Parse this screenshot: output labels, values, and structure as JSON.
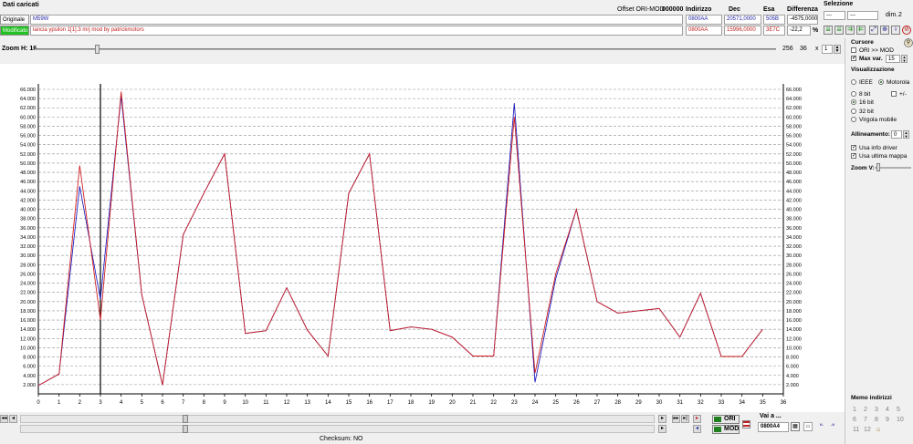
{
  "header": {
    "title": "Dati caricati",
    "offset_label": "Offset ORI-MOD",
    "offset_value": "000000",
    "col_address": "Indirizzo",
    "col_dec": "Dec",
    "col_hex": "Esa",
    "col_diff": "Differenza",
    "original_tag": "Originale",
    "original_name": "M59W",
    "original_address": "0800AA",
    "original_dec": "20571,0000",
    "original_hex": "505B",
    "original_diff": "-4575,0000",
    "modified_tag": "Modificato",
    "modified_name": "lancia ypsilon 1[1].3 mrj mod by patrickmotors",
    "modified_address": "0800AA",
    "modified_dec": "15996,0000",
    "modified_hex": "3E7C",
    "modified_diff": "-22,2",
    "percent": "%"
  },
  "selection": {
    "title": "Selezione",
    "field1": "---",
    "field2": "---",
    "dim_label": "dim.",
    "dim_value": "2"
  },
  "zoom": {
    "label": "Zoom H: 16",
    "value1": "256",
    "value2": "36",
    "x_label": "x",
    "value3": "1"
  },
  "panel": {
    "cursor_title": "Cursore",
    "ori_mod": "ORI >> MOD",
    "max_var_label": "Max var.",
    "max_var_value": "15",
    "view_title": "Visualizzazione",
    "ieee": "IEEE",
    "motorola": "Motorola",
    "bit8": "8 bit",
    "plusminus": "+/-",
    "bit16": "16 bit",
    "bit32": "32 bit",
    "float": "Virgola mobile",
    "align_label": "Allineamento:",
    "align_value": "0",
    "use_driver": "Usa info driver",
    "use_last_map": "Usa ultima mappa",
    "zoom_v": "Zoom V:",
    "memo_title": "Memo indirizzi",
    "memo_items": [
      "1",
      "2",
      "3",
      "4",
      "5",
      "6",
      "7",
      "8",
      "9",
      "10",
      "11",
      "12"
    ]
  },
  "bottom": {
    "ori": "ORI",
    "mod": "MOD",
    "goto_label": "Vai a ...",
    "goto_value": "0800A4",
    "checksum": "Checksum: NO"
  },
  "colors": {
    "original": "#2020c0",
    "modified": "#d02020",
    "grid": "#909090"
  },
  "chart_data": {
    "type": "line",
    "x": [
      0,
      1,
      2,
      3,
      4,
      5,
      6,
      7,
      8,
      9,
      10,
      11,
      12,
      13,
      14,
      15,
      16,
      17,
      18,
      19,
      20,
      21,
      22,
      23,
      24,
      25,
      26,
      27,
      28,
      29,
      30,
      31,
      32,
      33,
      34,
      35
    ],
    "xlim": [
      0,
      36
    ],
    "ylim": [
      0,
      66000
    ],
    "yticks": [
      "2.000",
      "4.000",
      "6.000",
      "8.000",
      "10.000",
      "12.000",
      "14.000",
      "16.000",
      "18.000",
      "20.000",
      "22.000",
      "24.000",
      "26.000",
      "28.000",
      "30.000",
      "32.000",
      "34.000",
      "36.000",
      "38.000",
      "40.000",
      "42.000",
      "44.000",
      "46.000",
      "48.000",
      "50.000",
      "52.000",
      "54.000",
      "56.000",
      "58.000",
      "60.000",
      "62.000",
      "64.000",
      "66.000"
    ],
    "xticks": [
      "0",
      "1",
      "2",
      "3",
      "4",
      "5",
      "6",
      "7",
      "8",
      "9",
      "10",
      "11",
      "12",
      "13",
      "14",
      "15",
      "16",
      "17",
      "18",
      "19",
      "20",
      "21",
      "22",
      "23",
      "24",
      "25",
      "26",
      "27",
      "28",
      "29",
      "30",
      "31",
      "32",
      "33",
      "34",
      "35",
      "36"
    ],
    "cursor_x": 3,
    "series": [
      {
        "values": [
          1800,
          4300,
          45000,
          20500,
          64500,
          21500,
          1900,
          34500,
          43500,
          52000,
          13100,
          13700,
          23000,
          13800,
          8200,
          43500,
          52000,
          13700,
          14500,
          14000,
          12300,
          8200,
          8200,
          63000,
          2500,
          25000,
          40000,
          20000,
          17500,
          18000,
          18500,
          12300,
          21800,
          8100,
          8100,
          14000
        ],
        "color": "#2020c0"
      },
      {
        "values": [
          1800,
          4300,
          49500,
          16000,
          65500,
          21500,
          1900,
          34500,
          43500,
          52000,
          13100,
          13700,
          23000,
          13800,
          8200,
          43500,
          52000,
          13700,
          14500,
          14000,
          12300,
          8200,
          8200,
          60000,
          4500,
          26000,
          40000,
          20000,
          17500,
          18000,
          18500,
          12300,
          21800,
          8100,
          8100,
          14000
        ],
        "color": "#d02020"
      }
    ]
  }
}
